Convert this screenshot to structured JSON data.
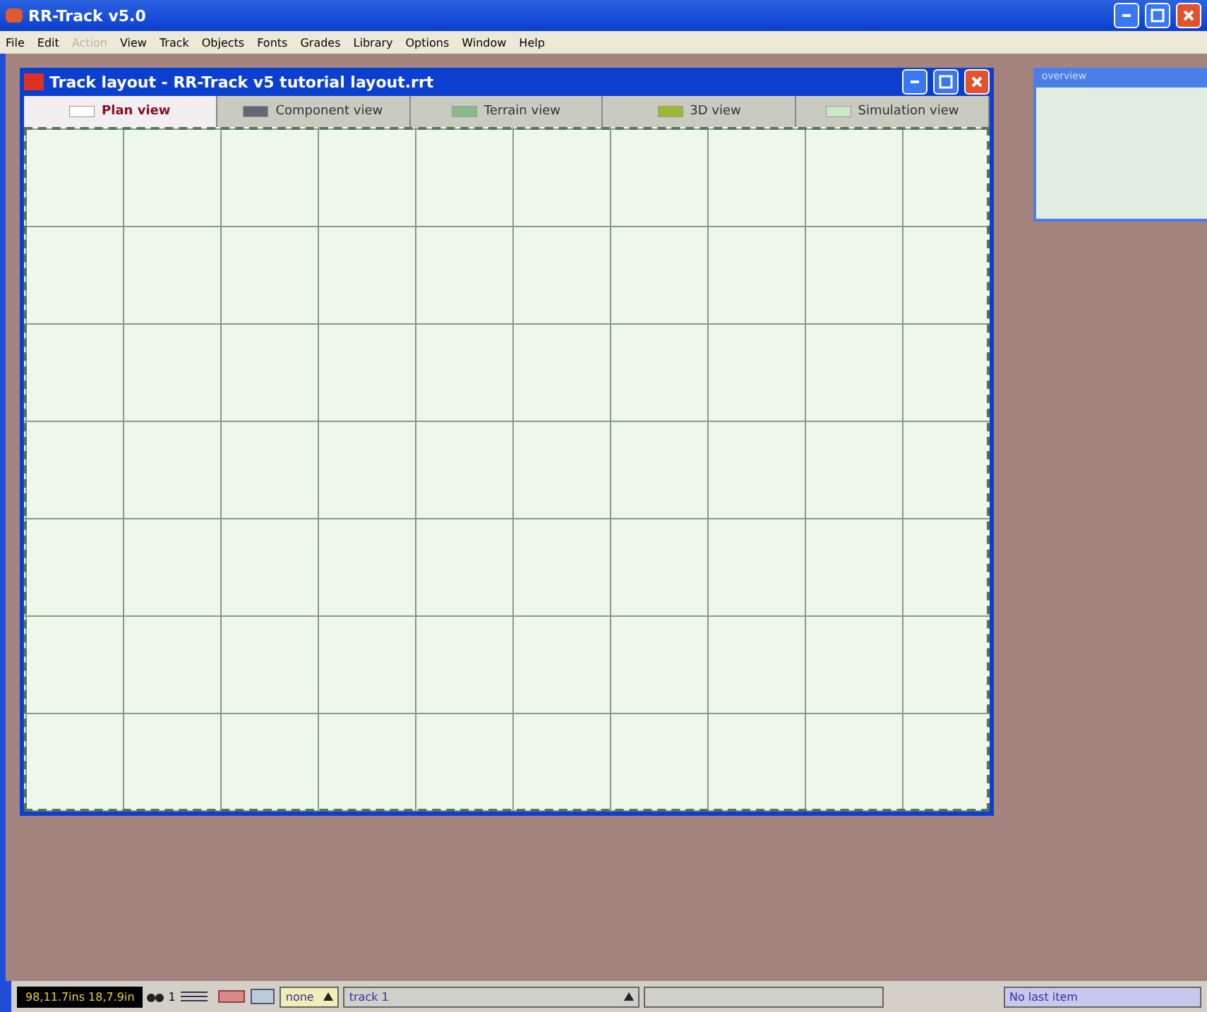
{
  "window": {
    "title": "RR-Track v5.0"
  },
  "menu": [
    {
      "label": "File",
      "disabled": false
    },
    {
      "label": "Edit",
      "disabled": false
    },
    {
      "label": "Action",
      "disabled": true
    },
    {
      "label": "View",
      "disabled": false
    },
    {
      "label": "Track",
      "disabled": false
    },
    {
      "label": "Objects",
      "disabled": false
    },
    {
      "label": "Fonts",
      "disabled": false
    },
    {
      "label": "Grades",
      "disabled": false
    },
    {
      "label": "Library",
      "disabled": false
    },
    {
      "label": "Options",
      "disabled": false
    },
    {
      "label": "Window",
      "disabled": false
    },
    {
      "label": "Help",
      "disabled": false
    }
  ],
  "document": {
    "title": "Track layout - RR-Track v5 tutorial layout.rrt",
    "tabs": [
      {
        "label": "Plan view",
        "selected": true
      },
      {
        "label": "Component view",
        "selected": false
      },
      {
        "label": "Terrain view",
        "selected": false
      },
      {
        "label": "3D view",
        "selected": false
      },
      {
        "label": "Simulation view",
        "selected": false
      }
    ]
  },
  "overview": {
    "title": "overview"
  },
  "status_bar": {
    "coordinates": "98,11.7ins 18,7.9in",
    "selection_count": "1",
    "grade": "none",
    "track": "track 1",
    "last_item": "No last item"
  }
}
